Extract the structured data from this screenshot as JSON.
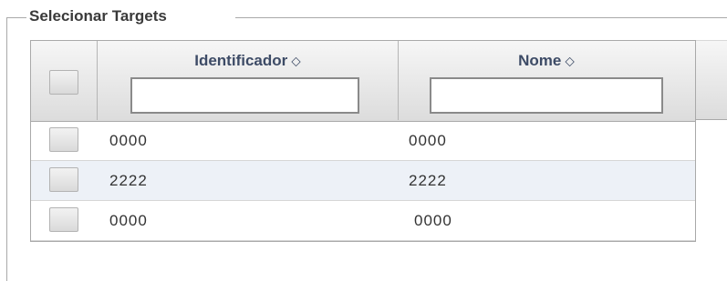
{
  "panel": {
    "title": "Selecionar Targets"
  },
  "table": {
    "columns": [
      {
        "label": "Identificador",
        "filter_value": ""
      },
      {
        "label": "Nome",
        "filter_value": ""
      }
    ],
    "sort_icon": "◇",
    "rows": [
      {
        "identificador": "0000",
        "nome": "0000"
      },
      {
        "identificador": "2222",
        "nome": "2222"
      },
      {
        "identificador": "0000",
        "nome": "0000"
      }
    ]
  }
}
